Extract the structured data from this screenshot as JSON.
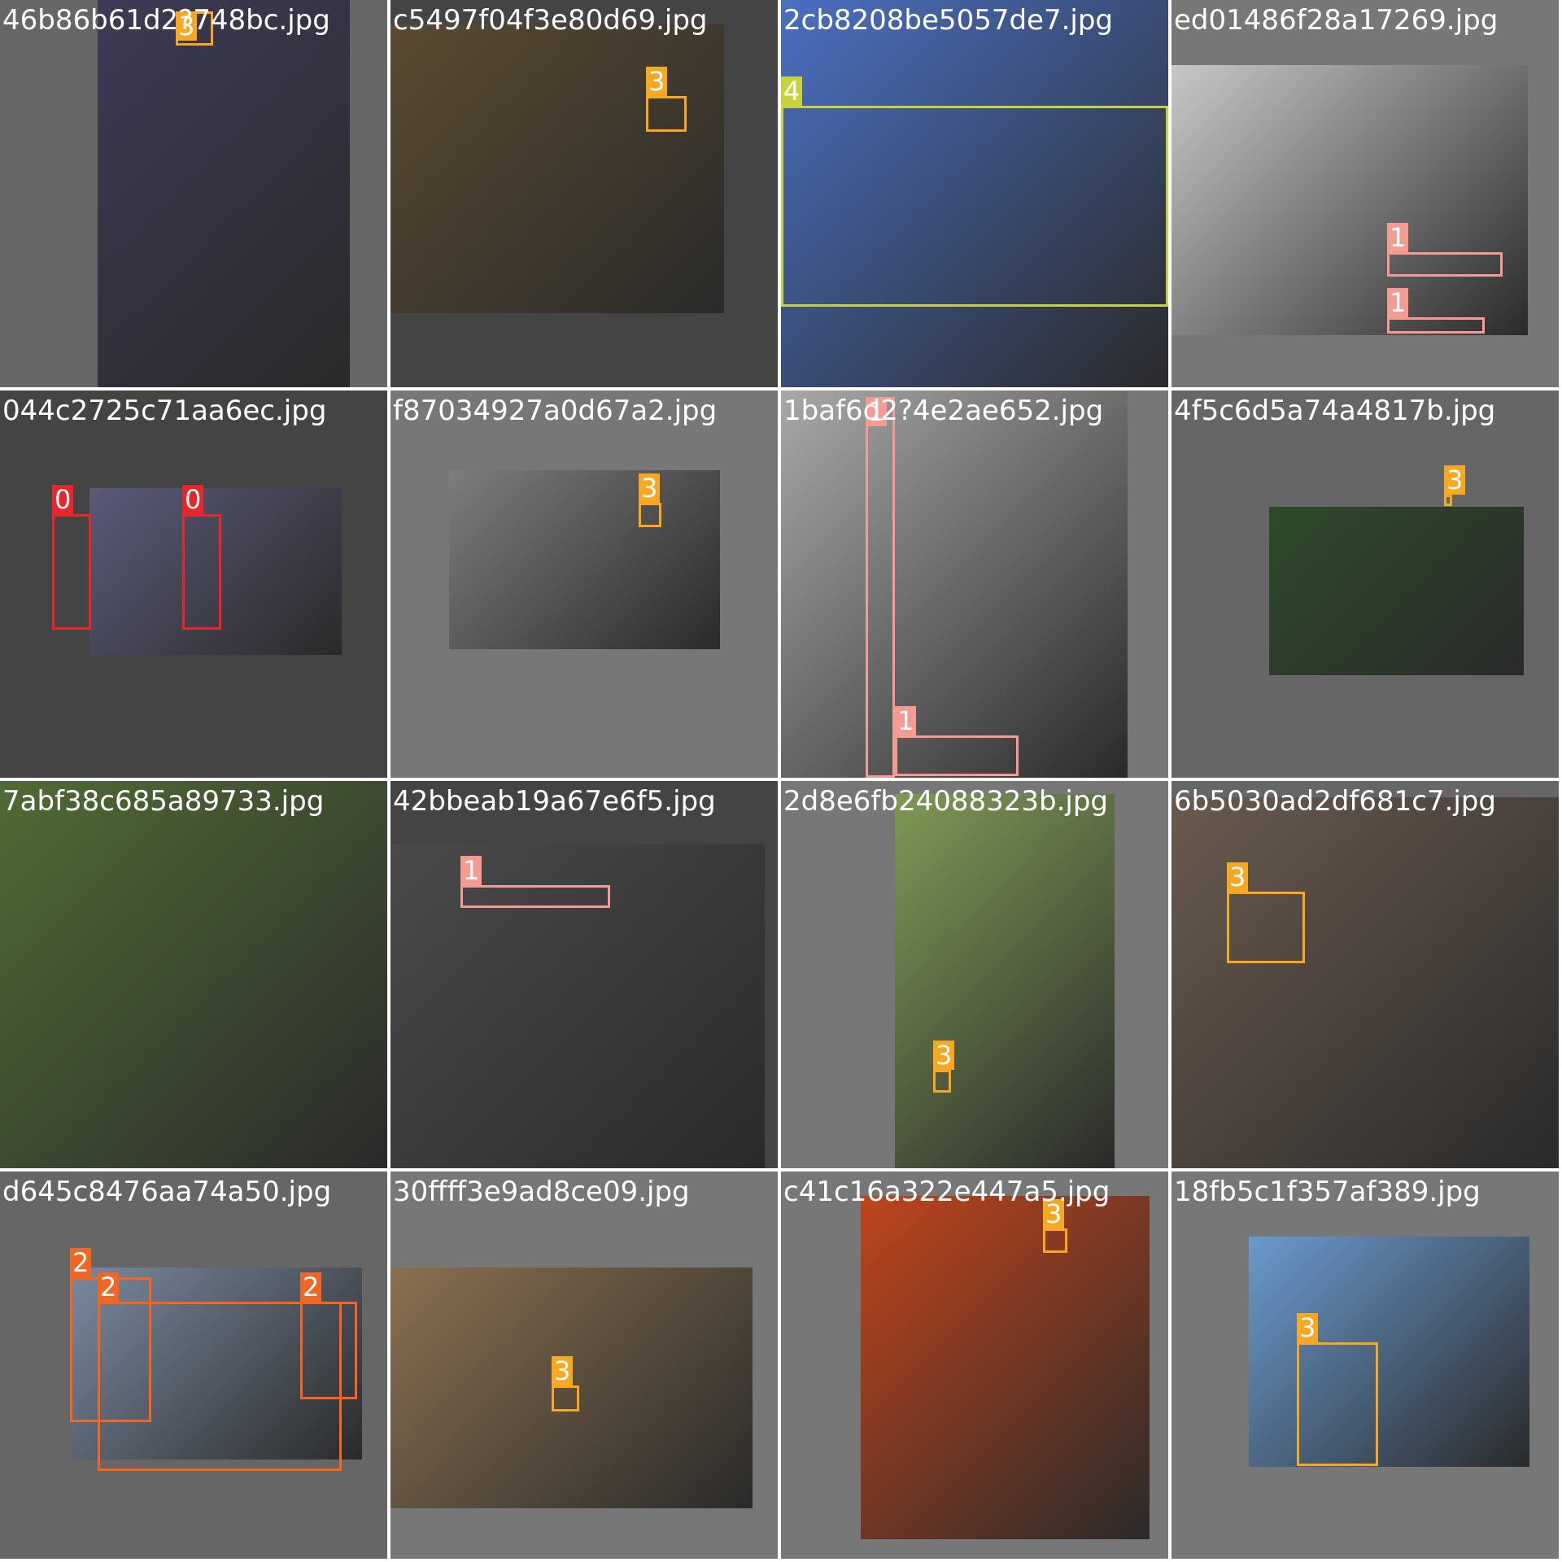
{
  "grid_title": "",
  "class_colors": {
    "0": "#e8262b",
    "1": "#f59b92",
    "2": "#f26522",
    "3": "#f7a823",
    "4": "#c9d23a"
  },
  "tiles": [
    {
      "filename": "46b86b61d2?748bc.jpg",
      "bg": "#666666",
      "photo_color": "#3d3a55",
      "boxes": [
        {
          "label": "3"
        }
      ]
    },
    {
      "filename": "c5497f04f3e80d69.jpg",
      "bg": "#444444",
      "photo_color": "#5a4a30",
      "boxes": [
        {
          "label": "3"
        }
      ]
    },
    {
      "filename": "2cb8208be5057de7.jpg",
      "bg": "#4a6fc2",
      "photo_color": "#4a6fc2",
      "boxes": [
        {
          "label": "4"
        }
      ]
    },
    {
      "filename": "ed01486f28a17269.jpg",
      "bg": "#777777",
      "photo_color": "#c8c8c8",
      "boxes": [
        {
          "label": "1"
        },
        {
          "label": "1"
        }
      ]
    },
    {
      "filename": "044c2725c71aa6ec.jpg",
      "bg": "#444444",
      "photo_color": "#5a5a7a",
      "boxes": [
        {
          "label": "0"
        },
        {
          "label": "0"
        }
      ]
    },
    {
      "filename": "f87034927a0d67a2.jpg",
      "bg": "#777777",
      "photo_color": "#7d7d7d",
      "boxes": [
        {
          "label": "3"
        }
      ]
    },
    {
      "filename": "1baf6d2?4e2ae652.jpg",
      "bg": "#777777",
      "photo_color": "#a8a8a8",
      "boxes": [
        {
          "label": "1"
        },
        {
          "label": "1"
        }
      ]
    },
    {
      "filename": "4f5c6d5a74a4817b.jpg",
      "bg": "#666666",
      "photo_color": "#2e4a2a",
      "boxes": [
        {
          "label": "3"
        }
      ]
    },
    {
      "filename": "7abf38c685a89733.jpg",
      "bg": "#777777",
      "photo_color": "#4f6b35",
      "boxes": []
    },
    {
      "filename": "42bbeab19a67e6f5.jpg",
      "bg": "#444444",
      "photo_color": "#4a4a4a",
      "boxes": [
        {
          "label": "1"
        }
      ]
    },
    {
      "filename": "2d8e6fb24088323b.jpg",
      "bg": "#777777",
      "photo_color": "#7e9a55",
      "boxes": [
        {
          "label": "3"
        }
      ]
    },
    {
      "filename": "6b5030ad2df681c7.jpg",
      "bg": "#666666",
      "photo_color": "#6a5a4e",
      "boxes": [
        {
          "label": "3"
        }
      ]
    },
    {
      "filename": "d645c8476aa74a50.jpg",
      "bg": "#666666",
      "photo_color": "#7a8aa0",
      "boxes": [
        {
          "label": "2"
        },
        {
          "label": "2"
        },
        {
          "label": "2"
        }
      ]
    },
    {
      "filename": "30ffff3e9ad8ce09.jpg",
      "bg": "#777777",
      "photo_color": "#8a7050",
      "boxes": [
        {
          "label": "3"
        }
      ]
    },
    {
      "filename": "c41c16a322e447a5.jpg",
      "bg": "#777777",
      "photo_color": "#c0441c",
      "boxes": [
        {
          "label": "3"
        }
      ]
    },
    {
      "filename": "18fb5c1f357af389.jpg",
      "bg": "#777777",
      "photo_color": "#6a9ad0",
      "boxes": [
        {
          "label": "3"
        }
      ]
    }
  ]
}
